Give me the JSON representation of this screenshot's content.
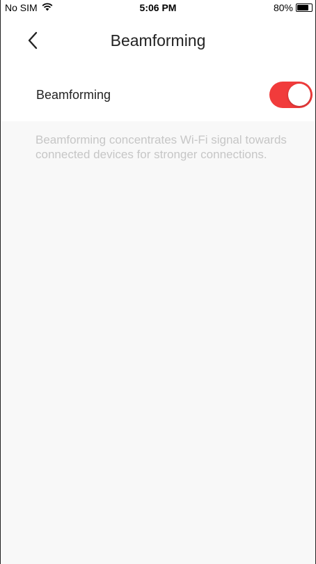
{
  "status_bar": {
    "carrier": "No SIM",
    "time": "5:06 PM",
    "battery_percent_label": "80%",
    "battery_level": 0.8,
    "wifi_icon": "wifi-icon",
    "battery_icon": "battery-icon"
  },
  "nav": {
    "back_icon": "chevron-left-icon",
    "title": "Beamforming"
  },
  "setting": {
    "label": "Beamforming",
    "enabled": true,
    "accent_color": "#f13b3b"
  },
  "description": "Beamforming concentrates Wi-Fi signal towards connected devices for stronger connections."
}
